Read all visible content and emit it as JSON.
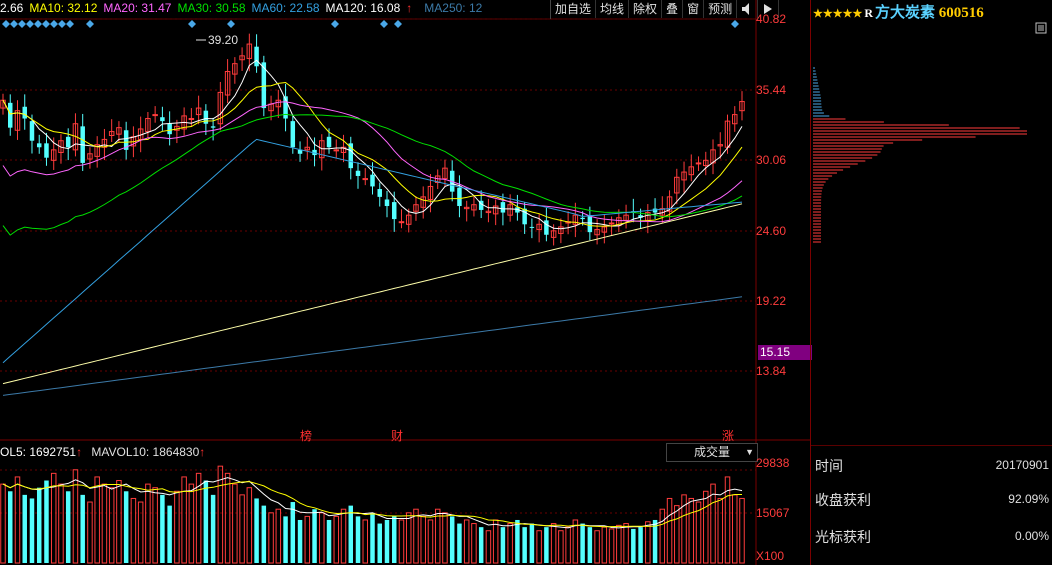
{
  "ma_legend": {
    "ma5_value": "2.66",
    "ma10": "MA10: 32.12",
    "ma20": "MA20: 31.47",
    "ma30": "MA30: 30.58",
    "ma60": "MA60: 22.58",
    "ma120": "MA120: 16.08",
    "ma250": "MA250: 12",
    "up_arrow": "↑",
    "colors": {
      "ma5": "#ffffff",
      "ma10": "#ffff00",
      "ma20": "#ff66ff",
      "ma30": "#00e000",
      "ma60": "#33a0e0",
      "ma120": "#ffffaa",
      "ma250": "#3c7aa8"
    }
  },
  "toolbar": {
    "items": [
      "加自选",
      "均线",
      "除权",
      "叠",
      "窗",
      "预测"
    ],
    "icons": [
      "speaker-icon",
      "right-arrow-icon"
    ]
  },
  "price_axis": {
    "ticks": [
      "40.82",
      "35.44",
      "30.06",
      "24.60",
      "19.22",
      "13.84"
    ],
    "current_price_tag": "15.15",
    "high_label": "39.20"
  },
  "event_markers": {
    "bang": "榜",
    "cai": "财",
    "zhang": "涨"
  },
  "volume": {
    "vol5_label": "OL5: 1692751",
    "mavol10_label": "MAVOL10: 1864830",
    "select_value": "成交量",
    "axis_ticks": [
      "29838",
      "15067",
      "X100"
    ]
  },
  "right_panel": {
    "stars": "★★★★★",
    "rating_suffix": "R",
    "stock_name": "方大炭素",
    "stock_code": "600516",
    "rows": [
      {
        "label": "时间",
        "value": "20170901"
      },
      {
        "label": "收盘获利",
        "value": "92.09%"
      },
      {
        "label": "光标获利",
        "value": "0.00%"
      }
    ]
  },
  "chart_data": {
    "type": "candlestick",
    "y_axis_ticks": [
      40.82,
      35.44,
      30.06,
      24.6,
      19.22,
      13.84
    ],
    "ylim": [
      13.84,
      40.82
    ],
    "high_annotation": 39.2,
    "current_price": 15.15,
    "volume_axis_ticks": [
      29838,
      15067
    ],
    "volume_unit": "X100",
    "grid": true
  }
}
